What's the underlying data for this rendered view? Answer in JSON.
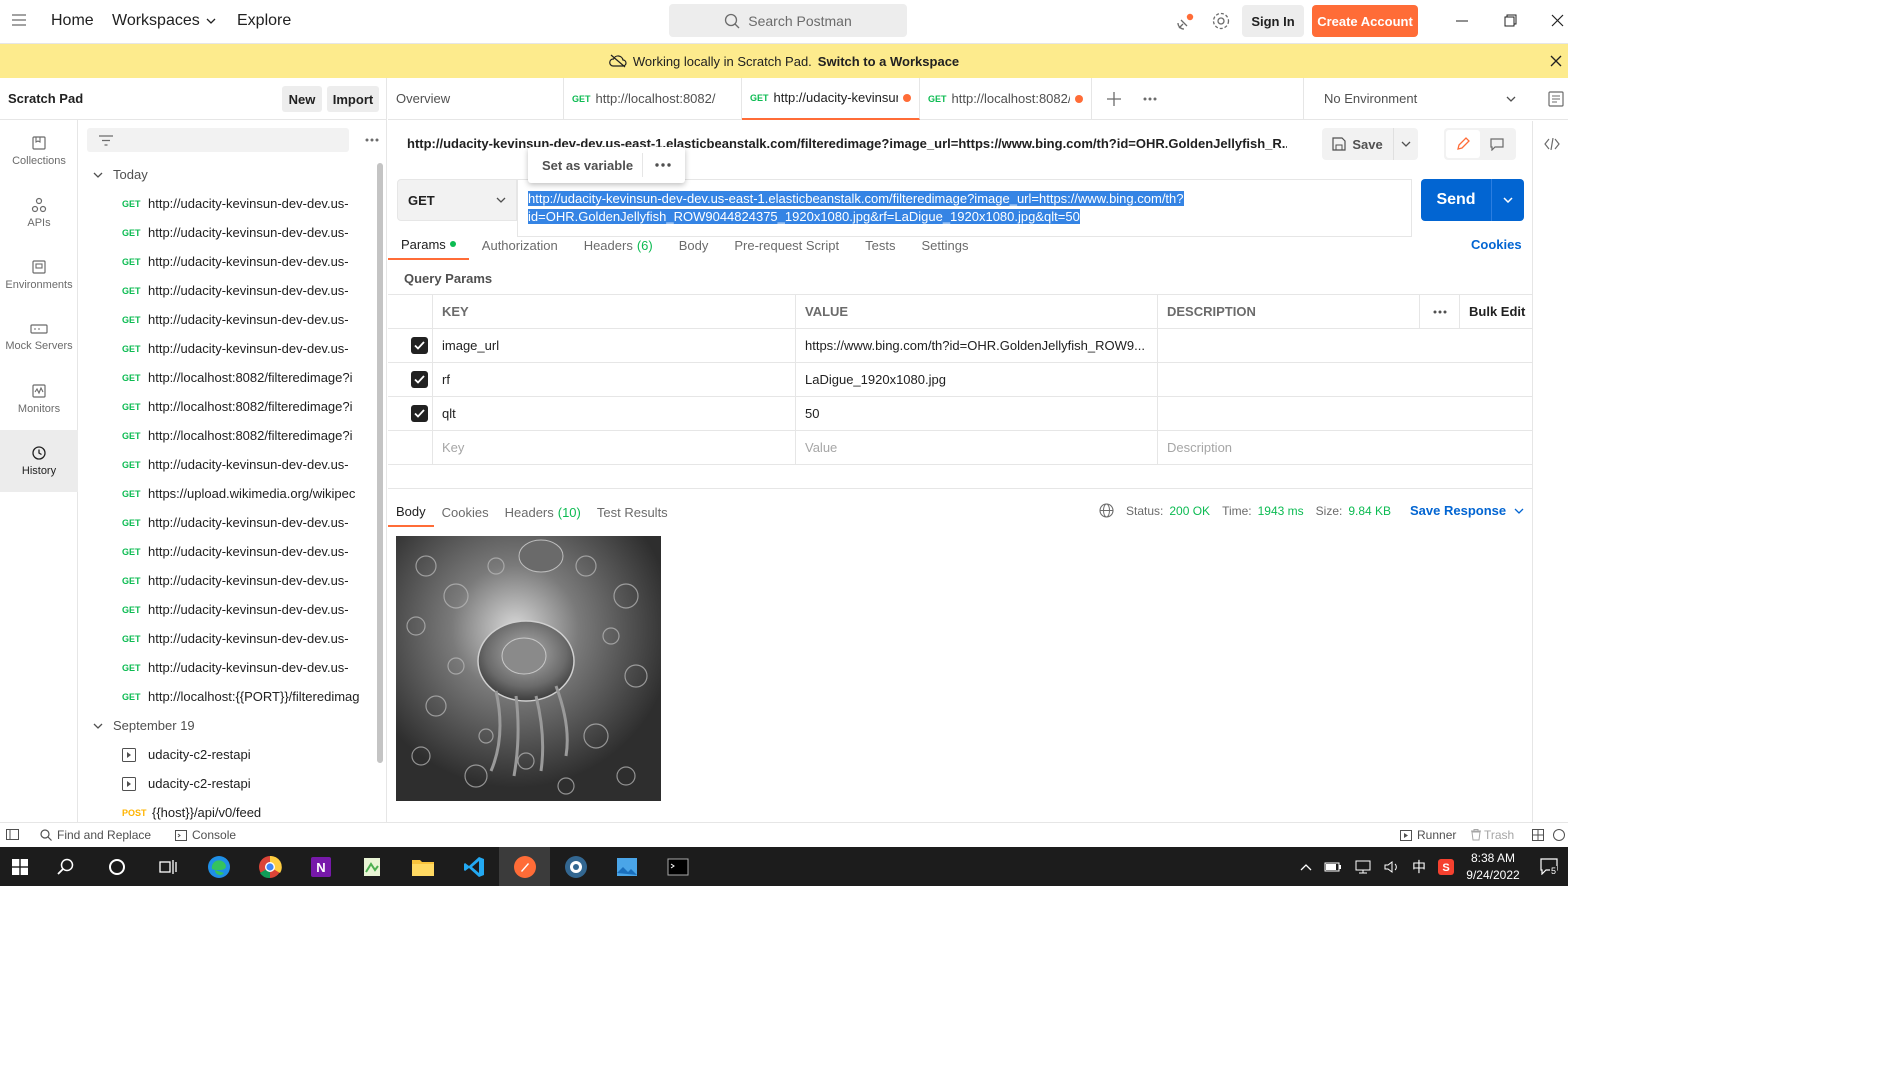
{
  "topbar": {
    "nav": [
      "Home",
      "Workspaces",
      "Explore"
    ],
    "search_placeholder": "Search Postman",
    "sign_in": "Sign In",
    "create_account": "Create Account"
  },
  "banner": {
    "text": "Working locally in Scratch Pad.",
    "link": "Switch to a Workspace"
  },
  "sidebar": {
    "title": "Scratch Pad",
    "new_label": "New",
    "import_label": "Import",
    "rail": [
      {
        "label": "Collections",
        "icon": "collections-icon"
      },
      {
        "label": "APIs",
        "icon": "apis-icon"
      },
      {
        "label": "Environments",
        "icon": "environments-icon"
      },
      {
        "label": "Mock Servers",
        "icon": "mock-servers-icon"
      },
      {
        "label": "Monitors",
        "icon": "monitors-icon"
      },
      {
        "label": "History",
        "icon": "history-icon"
      }
    ],
    "groups": [
      {
        "label": "Today",
        "items": [
          {
            "method": "GET",
            "url": "http://udacity-kevinsun-dev-dev.us-"
          },
          {
            "method": "GET",
            "url": "http://udacity-kevinsun-dev-dev.us-"
          },
          {
            "method": "GET",
            "url": "http://udacity-kevinsun-dev-dev.us-"
          },
          {
            "method": "GET",
            "url": "http://udacity-kevinsun-dev-dev.us-"
          },
          {
            "method": "GET",
            "url": "http://udacity-kevinsun-dev-dev.us-"
          },
          {
            "method": "GET",
            "url": "http://udacity-kevinsun-dev-dev.us-"
          },
          {
            "method": "GET",
            "url": "http://localhost:8082/filteredimage?i"
          },
          {
            "method": "GET",
            "url": "http://localhost:8082/filteredimage?i"
          },
          {
            "method": "GET",
            "url": "http://localhost:8082/filteredimage?i"
          },
          {
            "method": "GET",
            "url": "http://udacity-kevinsun-dev-dev.us-"
          },
          {
            "method": "GET",
            "url": "https://upload.wikimedia.org/wikipec"
          },
          {
            "method": "GET",
            "url": "http://udacity-kevinsun-dev-dev.us-"
          },
          {
            "method": "GET",
            "url": "http://udacity-kevinsun-dev-dev.us-"
          },
          {
            "method": "GET",
            "url": "http://udacity-kevinsun-dev-dev.us-"
          },
          {
            "method": "GET",
            "url": "http://udacity-kevinsun-dev-dev.us-"
          },
          {
            "method": "GET",
            "url": "http://udacity-kevinsun-dev-dev.us-"
          },
          {
            "method": "GET",
            "url": "http://udacity-kevinsun-dev-dev.us-"
          },
          {
            "method": "GET",
            "url": "http://localhost:{{PORT}}/filteredimag"
          }
        ]
      },
      {
        "label": "September 19",
        "items": [
          {
            "method": "",
            "url": "udacity-c2-restapi"
          },
          {
            "method": "",
            "url": "udacity-c2-restapi"
          },
          {
            "method": "POST",
            "url": "{{host}}/api/v0/feed"
          }
        ]
      }
    ]
  },
  "tabs": {
    "items": [
      {
        "method": "",
        "label": "Overview"
      },
      {
        "method": "GET",
        "label": "http://localhost:8082/"
      },
      {
        "method": "GET",
        "label": "http://udacity-kevinsur"
      },
      {
        "method": "GET",
        "label": "http://localhost:8082/f"
      }
    ],
    "environment": "No Environment"
  },
  "request": {
    "title": "http://udacity-kevinsun-dev-dev.us-east-1.elasticbeanstalk.com/filteredimage?image_url=https://www.bing.com/th?id=OHR.GoldenJellyfish_R...",
    "save": "Save",
    "popup_label": "Set as variable",
    "method": "GET",
    "url_line1": "http://udacity-kevinsun-dev-dev.us-east-1.elasticbeanstalk.com/filteredimage?image_url=https://www.bing.com/th?",
    "url_line2": "id=OHR.GoldenJellyfish_ROW9044824375_1920x1080.jpg&rf=LaDigue_1920x1080.jpg&qlt=50",
    "send": "Send",
    "cookies": "Cookies",
    "subtabs": [
      "Params",
      "Authorization",
      "Headers",
      "Body",
      "Pre-request Script",
      "Tests",
      "Settings"
    ],
    "headers_count": "(6)",
    "query_params_title": "Query Params"
  },
  "params": {
    "headers": {
      "key": "KEY",
      "value": "VALUE",
      "description": "DESCRIPTION",
      "bulk_edit": "Bulk Edit"
    },
    "rows": [
      {
        "key": "image_url",
        "value": "https://www.bing.com/th?id=OHR.GoldenJellyfish_ROW9...",
        "description": ""
      },
      {
        "key": "rf",
        "value": "LaDigue_1920x1080.jpg",
        "description": ""
      },
      {
        "key": "qlt",
        "value": "50",
        "description": ""
      }
    ],
    "placeholders": {
      "key": "Key",
      "value": "Value",
      "description": "Description"
    }
  },
  "response": {
    "tabs": [
      "Body",
      "Cookies",
      "Headers",
      "Test Results"
    ],
    "headers_count": "(10)",
    "status_label": "Status:",
    "status_value": "200 OK",
    "time_label": "Time:",
    "time_value": "1943 ms",
    "size_label": "Size:",
    "size_value": "9.84 KB",
    "save_response": "Save Response"
  },
  "footer": {
    "find_replace": "Find and Replace",
    "console": "Console",
    "runner": "Runner",
    "trash": "Trash"
  },
  "taskbar": {
    "time": "8:38 AM",
    "date": "9/24/2022",
    "ime": "中",
    "notif_count": "5"
  },
  "colors": {
    "accent": "#ff6c37",
    "send_blue": "#0265d2",
    "link_blue": "#0265d2",
    "status_green": "#0cbb52",
    "banner_yellow": "#fdeb8d"
  }
}
